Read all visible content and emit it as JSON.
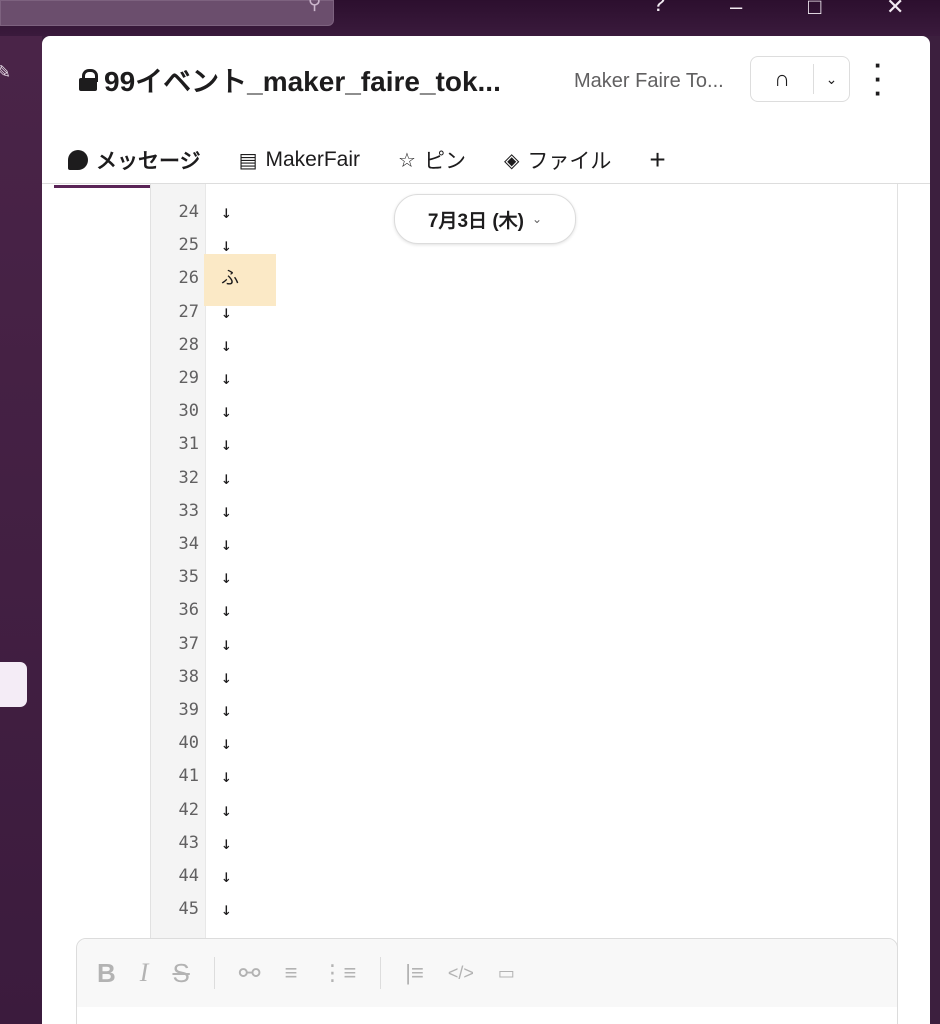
{
  "colors": {
    "sidebar": "#3c1f3e",
    "accent": "#5a2457",
    "highlight": "#fbe9c6"
  },
  "window_controls": {
    "help_icon": "help-circle-icon",
    "minimize": "minimize-icon",
    "maximize": "maximize-icon",
    "close": "close-icon"
  },
  "channel": {
    "name": "99イベント_maker_faire_tok...",
    "description": "Maker Faire To...",
    "huddle_icon": "headphones-icon"
  },
  "tabs": [
    {
      "label": "メッセージ",
      "icon": "message-bubble-icon",
      "active": true
    },
    {
      "label": "MakerFair",
      "icon": "canvas-icon",
      "active": false
    },
    {
      "label": "ピン",
      "icon": "pin-icon",
      "active": false
    },
    {
      "label": "ファイル",
      "icon": "files-icon",
      "active": false
    }
  ],
  "date_divider": "7月3日 (木)",
  "code_lines": [
    {
      "n": "24",
      "t": "↓"
    },
    {
      "n": "25",
      "t": "↓"
    },
    {
      "n": "26",
      "t": "ふ"
    },
    {
      "n": "27",
      "t": "↓"
    },
    {
      "n": "28",
      "t": "↓"
    },
    {
      "n": "29",
      "t": "↓"
    },
    {
      "n": "30",
      "t": "↓"
    },
    {
      "n": "31",
      "t": "↓"
    },
    {
      "n": "32",
      "t": "↓"
    },
    {
      "n": "33",
      "t": "↓"
    },
    {
      "n": "34",
      "t": "↓"
    },
    {
      "n": "35",
      "t": "↓"
    },
    {
      "n": "36",
      "t": "↓"
    },
    {
      "n": "37",
      "t": "↓"
    },
    {
      "n": "38",
      "t": "↓"
    },
    {
      "n": "39",
      "t": "↓"
    },
    {
      "n": "40",
      "t": "↓"
    },
    {
      "n": "41",
      "t": "↓"
    },
    {
      "n": "42",
      "t": "↓"
    },
    {
      "n": "43",
      "t": "↓"
    },
    {
      "n": "44",
      "t": "↓"
    },
    {
      "n": "45",
      "t": "↓"
    }
  ],
  "formatting": [
    "bold-icon",
    "italic-icon",
    "strikethrough-icon",
    "link-icon",
    "ordered-list-icon",
    "bulleted-list-icon",
    "blockquote-icon",
    "code-icon",
    "code-block-icon"
  ]
}
